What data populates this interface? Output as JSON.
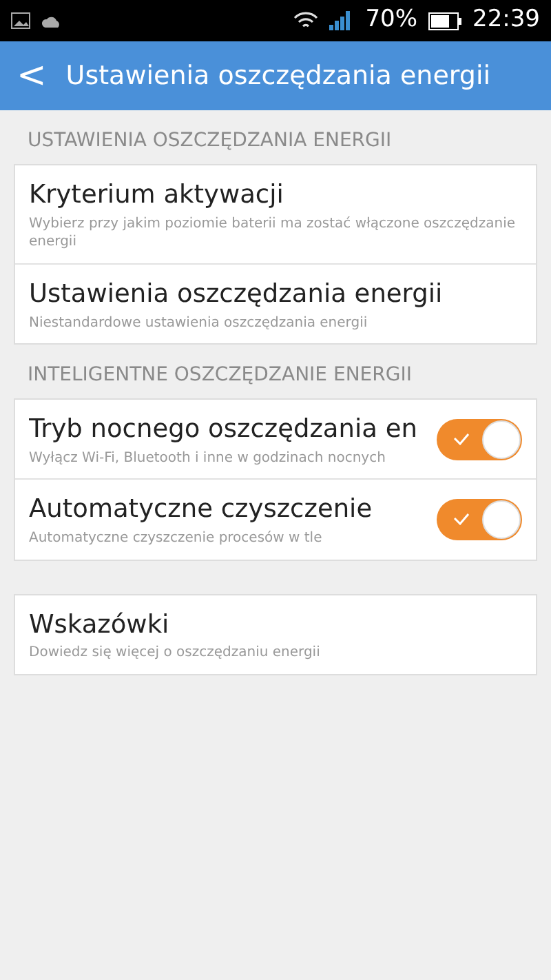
{
  "status_bar": {
    "battery": "70%",
    "time": "22:39"
  },
  "header": {
    "back": "<",
    "title": "Ustawienia oszczędzania energii"
  },
  "sections": [
    {
      "heading": "USTAWIENIA OSZCZĘDZANIA ENERGII",
      "items": [
        {
          "kind": "link",
          "title": "Kryterium aktywacji",
          "subtitle": "Wybierz przy jakim poziomie baterii ma zostać włączone oszczędzanie energii"
        },
        {
          "kind": "link",
          "title": "Ustawienia oszczędzania energii",
          "subtitle": "Niestandardowe ustawienia oszczędzania energii"
        }
      ]
    },
    {
      "heading": "INTELIGENTNE OSZCZĘDZANIE ENERGII",
      "items": [
        {
          "kind": "toggle",
          "title": "Tryb nocnego oszczędzania en",
          "subtitle": "Wyłącz Wi-Fi, Bluetooth i inne w godzinach nocnych",
          "on": true
        },
        {
          "kind": "toggle",
          "title": "Automatyczne czyszczenie",
          "subtitle": "Automatyczne czyszczenie procesów w tle",
          "on": true
        }
      ]
    },
    {
      "items": [
        {
          "kind": "link",
          "title": "Wskazówki",
          "subtitle": "Dowiedz się więcej o oszczędzaniu energii"
        }
      ]
    }
  ]
}
